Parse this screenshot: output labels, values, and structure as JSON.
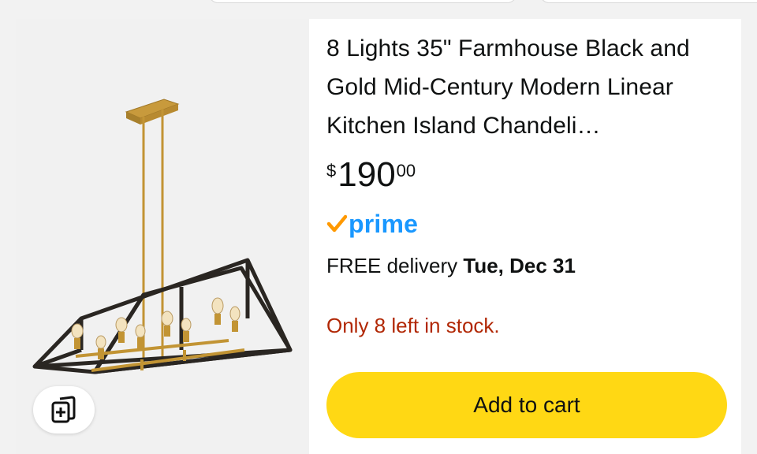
{
  "product": {
    "title": "8 Lights 35\" Farmhouse Black and Gold Mid-Century Modern Linear Kitchen Island Chandeli…",
    "price": {
      "symbol": "$",
      "whole": "190",
      "fraction": "00"
    },
    "prime_label": "prime",
    "delivery": {
      "prefix": "FREE delivery ",
      "date": "Tue, Dec 31"
    },
    "stock_message": "Only 8 left in stock.",
    "add_to_cart_label": "Add to cart"
  },
  "icons": {
    "prime_check": "prime-check-icon",
    "compare": "compare-icon"
  },
  "colors": {
    "prime_blue": "#1a98ff",
    "prime_check_orange": "#ff9900",
    "stock_red": "#b12704",
    "cart_button_yellow": "#ffd814",
    "text": "#0f1111"
  }
}
